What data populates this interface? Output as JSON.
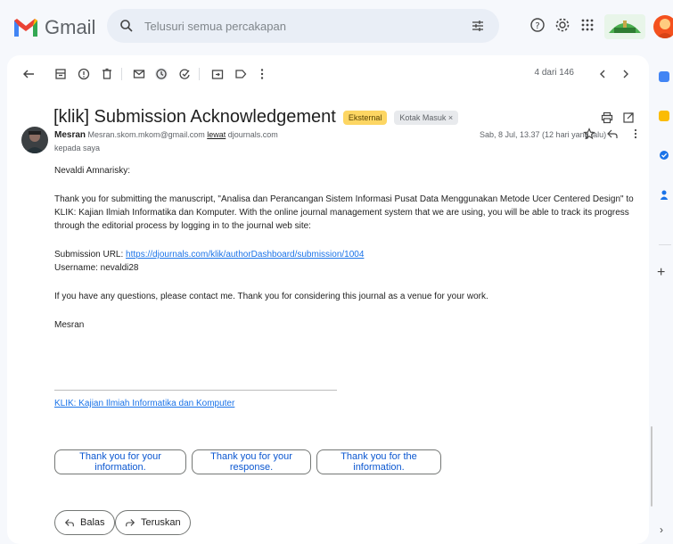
{
  "app": {
    "name": "Gmail"
  },
  "search": {
    "placeholder": "Telusuri semua percakapan"
  },
  "toolbar": {
    "pager": "4 dari 146"
  },
  "email": {
    "subject": "[klik] Submission Acknowledgement",
    "labels": {
      "external": "Eksternal",
      "inbox": "Kotak Masuk ×"
    },
    "sender": {
      "name": "Mesran",
      "address": "Mesran.skom.mkom@gmail.com",
      "via_word": "lewat",
      "via_domain": "djournals.com",
      "to": "kepada saya"
    },
    "date": "Sab, 8 Jul, 13.37 (12 hari yang lalu)",
    "body": {
      "greeting": "Nevaldi Amnarisky:",
      "paragraph1": "Thank you for submitting the manuscript, \"Analisa dan Perancangan Sistem Informasi Pusat Data Menggunakan Metode Ucer Centered Design\" to KLIK: Kajian Ilmiah Informatika dan Komputer. With the online journal management system that we are using, you will be able to track its progress through the editorial process by logging in to the journal web site:",
      "url_label": "Submission URL:",
      "url": "https://djournals.com/klik/authorDashboard/submission/1004",
      "username_line": "Username: nevaldi28",
      "paragraph2": "If you have any questions, please contact me. Thank you for considering this journal as a venue for your work.",
      "signoff": "Mesran",
      "journal_link": "KLIK: Kajian Ilmiah Informatika dan Komputer"
    },
    "smart_replies": [
      "Thank you for your information.",
      "Thank you for your response.",
      "Thank you for the information."
    ],
    "actions": {
      "reply": "Balas",
      "forward": "Teruskan"
    }
  },
  "colors": {
    "accent": "#1a73e8",
    "external_chip": "#fdd663",
    "background": "#f6f8fc"
  },
  "icons": [
    "gmail-logo-icon",
    "search-icon",
    "filter-icon",
    "help-icon",
    "settings-icon",
    "apps-icon",
    "back-icon",
    "archive-icon",
    "report-icon",
    "delete-icon",
    "mark-unread-icon",
    "snooze-icon",
    "add-task-icon",
    "move-to-icon",
    "label-icon",
    "more-icon",
    "prev-icon",
    "next-icon",
    "print-icon",
    "open-new-window-icon",
    "star-icon",
    "reply-icon"
  ]
}
